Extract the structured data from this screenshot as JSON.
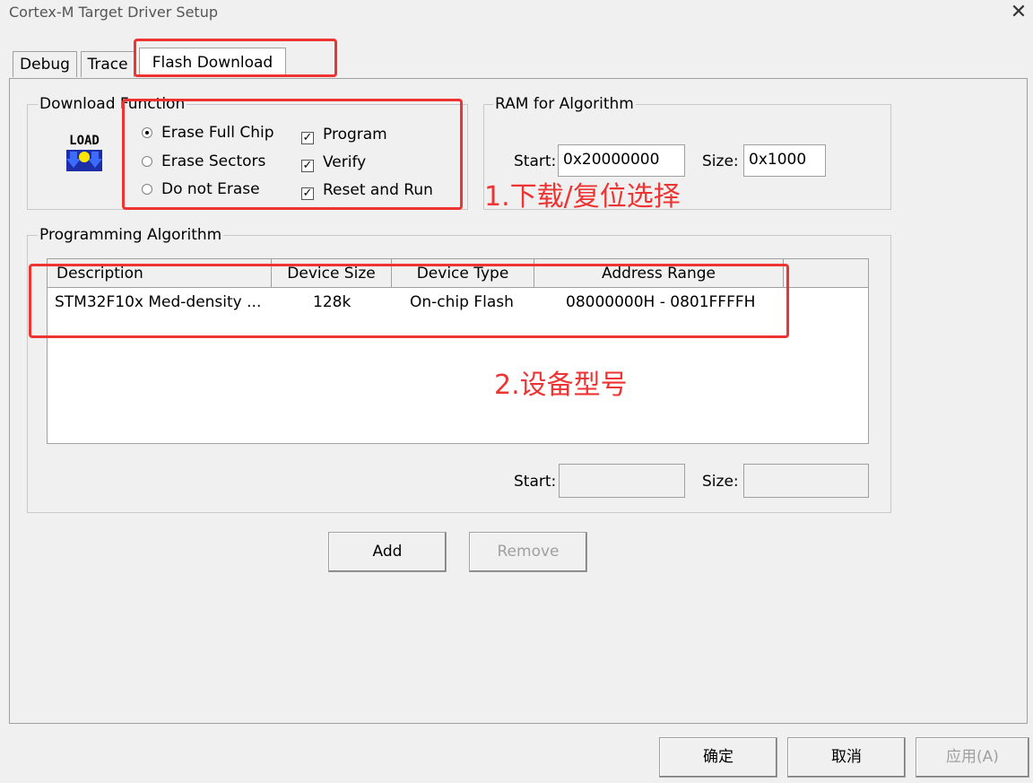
{
  "window": {
    "title": "Cortex-M Target Driver Setup"
  },
  "tabs": [
    {
      "label": "Debug"
    },
    {
      "label": "Trace"
    },
    {
      "label": "Flash Download"
    }
  ],
  "download_function": {
    "label": "Download Function",
    "erase_options": [
      {
        "label": "Erase Full Chip",
        "checked": true
      },
      {
        "label": "Erase Sectors",
        "checked": false
      },
      {
        "label": "Do not Erase",
        "checked": false
      }
    ],
    "checks": [
      {
        "label": "Program",
        "mark": "✓"
      },
      {
        "label": "Verify",
        "mark": "✓"
      },
      {
        "label": "Reset and Run",
        "mark": "✓"
      }
    ],
    "icon_text": "LOAD"
  },
  "ram": {
    "label": "RAM for Algorithm",
    "start_label": "Start:",
    "start_value": "0x20000000",
    "size_label": "Size:",
    "size_value": "0x1000"
  },
  "programming": {
    "label": "Programming Algorithm",
    "columns": [
      "Description",
      "Device Size",
      "Device Type",
      "Address Range"
    ],
    "rows": [
      [
        "STM32F10x Med-density ...",
        "128k",
        "On-chip Flash",
        "08000000H - 0801FFFFH"
      ]
    ],
    "start_label": "Start:",
    "start_value": "",
    "size_label": "Size:",
    "size_value": ""
  },
  "buttons": {
    "add": "Add",
    "remove": "Remove",
    "ok": "确定",
    "cancel": "取消",
    "apply": "应用(A)"
  },
  "annotations": {
    "one": "1.下载/复位选择",
    "two": "2.设备型号"
  },
  "colors": {
    "annotation": "#ee3333"
  }
}
